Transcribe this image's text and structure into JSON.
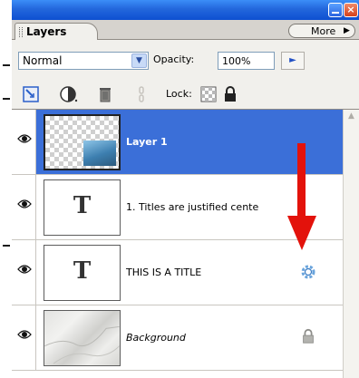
{
  "panel": {
    "tab_label": "Layers",
    "more_label": "More",
    "blend_mode": "Normal",
    "opacity_label": "Opacity:",
    "opacity_value": "100%",
    "lock_label": "Lock:"
  },
  "window_controls": {
    "minimize": "",
    "close": "×"
  },
  "layers": [
    {
      "name": "Layer 1",
      "selected": true,
      "visible": true,
      "thumbnail": "transparent-checker-with-image"
    },
    {
      "name": "1.  Titles are justified cente",
      "selected": false,
      "visible": true,
      "thumbnail": "type-layer",
      "glyph": "T"
    },
    {
      "name": "THIS IS A TITLE",
      "selected": false,
      "visible": true,
      "thumbnail": "type-layer",
      "glyph": "T",
      "status_icon": "effects-gear-icon"
    },
    {
      "name": "Background",
      "selected": false,
      "visible": true,
      "thumbnail": "marble-texture",
      "status_icon": "lock-icon"
    }
  ],
  "colors": {
    "titlebar": "#0d4fd1",
    "selection": "#3b6fd8",
    "annotation_arrow": "#e3120b"
  }
}
